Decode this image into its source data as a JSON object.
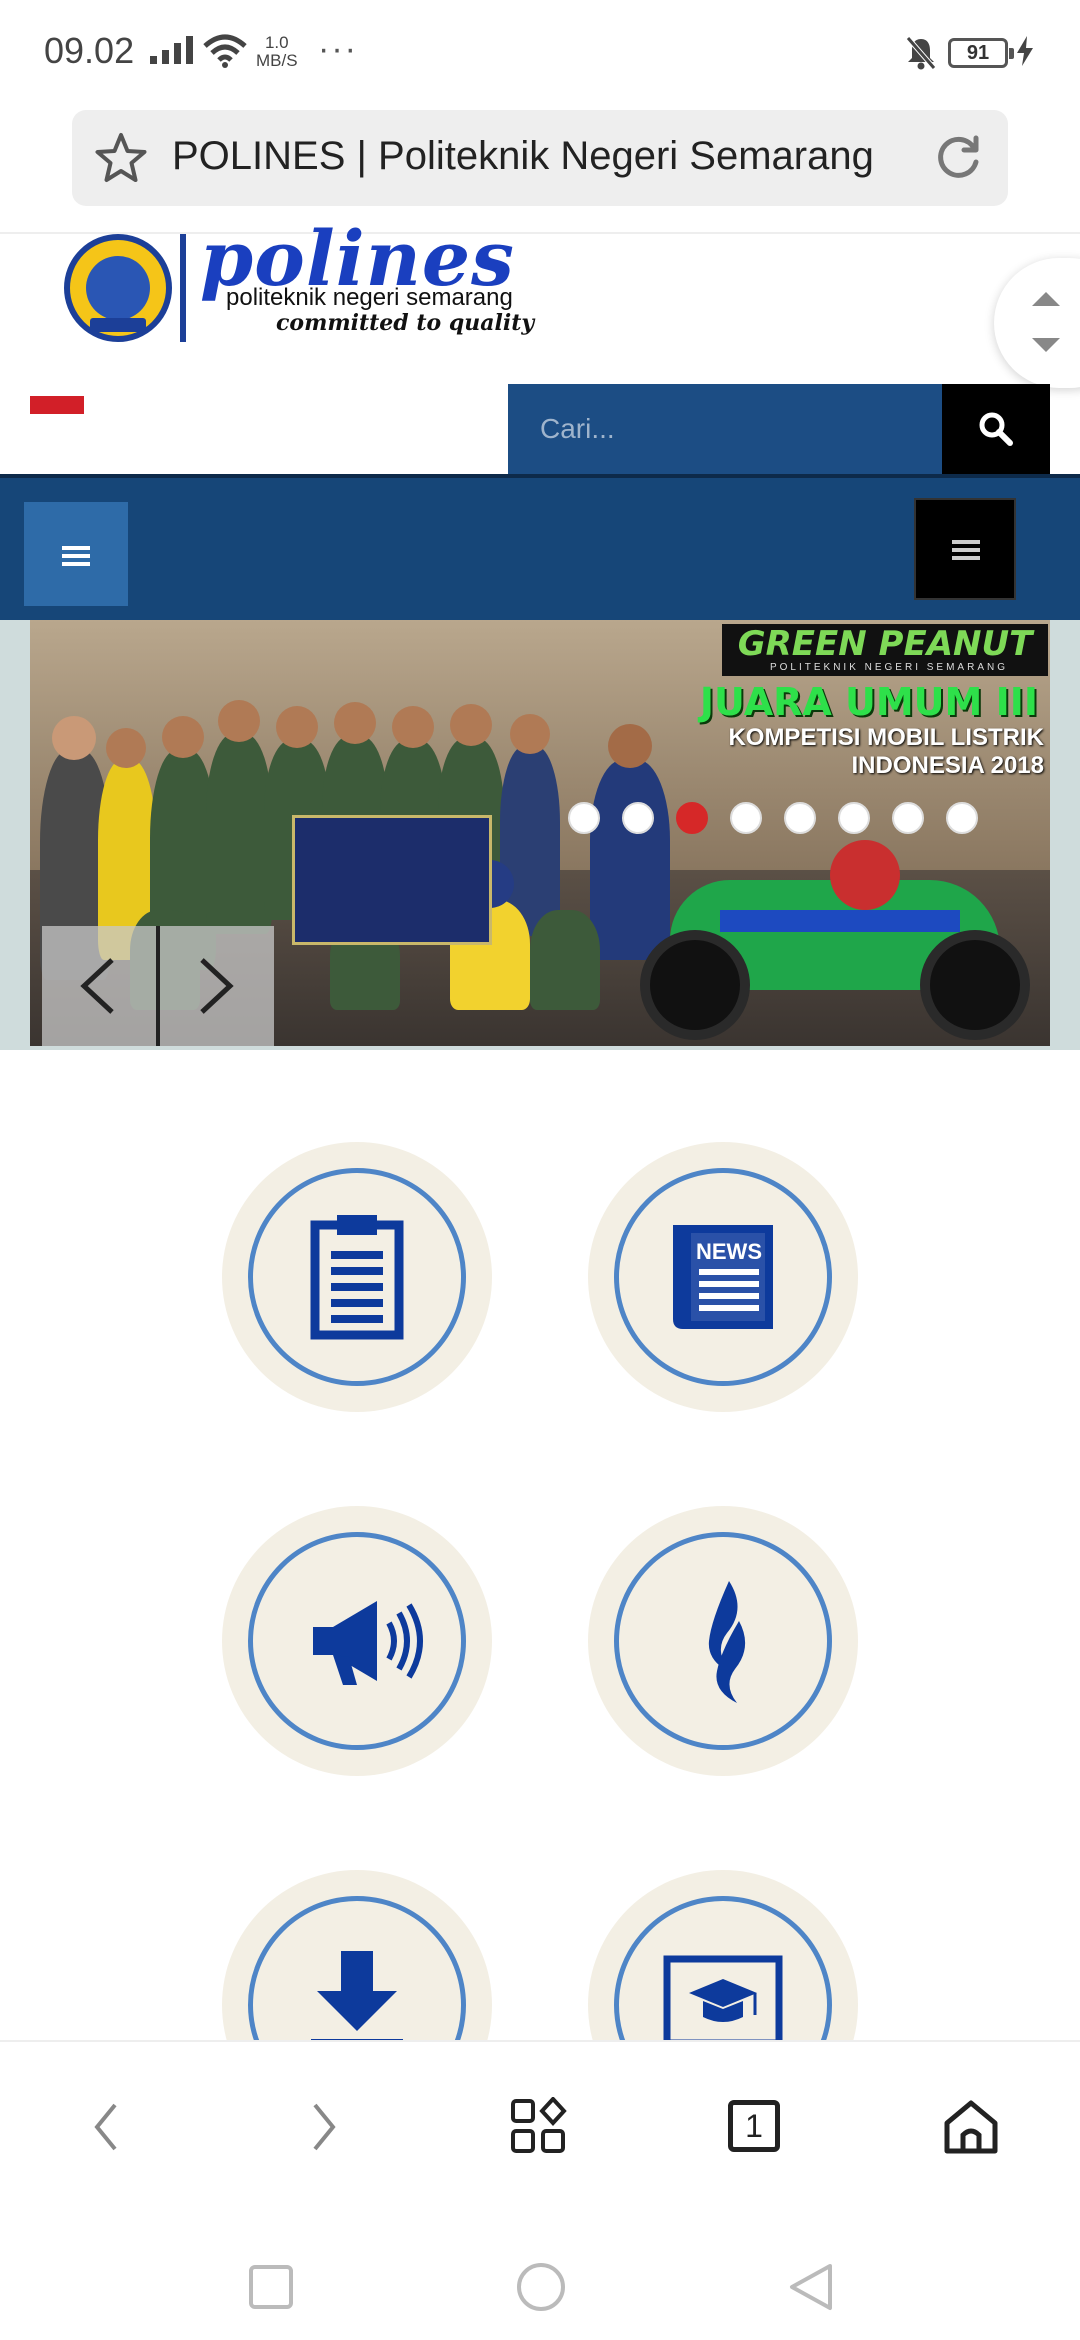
{
  "status_bar": {
    "time": "09.02",
    "net_speed_value": "1.0",
    "net_speed_unit": "MB/S",
    "more": "···",
    "battery": "91"
  },
  "browser": {
    "page_title": "POLINES | Politeknik Negeri Semarang"
  },
  "site": {
    "logo_word": "polines",
    "logo_subtitle": "politeknik negeri semarang",
    "logo_tagline": "committed to quality",
    "search_placeholder": "Cari...",
    "accent_color": "#164678",
    "search_color": "#1c4d84"
  },
  "slider": {
    "brand": "GREEN PEANUT",
    "brand_sub": "POLITEKNIK NEGERI SEMARANG",
    "headline": "JUARA UMUM III",
    "line1": "KOMPETISI  MOBIL LISTRIK",
    "line2": "INDONESIA 2018",
    "slide_count": 8,
    "active_slide": 3
  },
  "quick_links": [
    {
      "icon": "clipboard-icon"
    },
    {
      "icon": "news-icon",
      "text": "NEWS"
    },
    {
      "icon": "megaphone-icon"
    },
    {
      "icon": "flame-icon"
    },
    {
      "icon": "download-icon"
    },
    {
      "icon": "graduation-board-icon"
    }
  ],
  "toolbar": {
    "tab_count": "1"
  }
}
